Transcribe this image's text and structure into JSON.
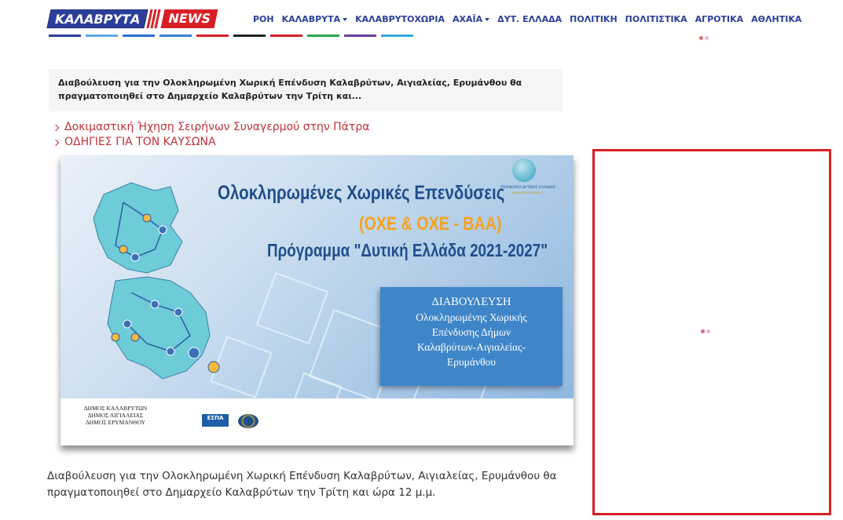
{
  "header": {
    "logo": {
      "main": "ΚΑΛΑΒΡΥΤΑ",
      "news": "NEWS"
    },
    "nav": [
      {
        "label": "ΡΟΗ",
        "dropdown": false
      },
      {
        "label": "ΚΑΛΑΒΡΥΤΑ",
        "dropdown": true
      },
      {
        "label": "ΚΑΛΑΒΡΥΤΟΧΩΡΙΑ",
        "dropdown": false
      },
      {
        "label": "ΑΧΑΪΑ",
        "dropdown": true
      },
      {
        "label": "ΔΥΤ. ΕΛΛΑΔΑ",
        "dropdown": false
      },
      {
        "label": "ΠΟΛΙΤΙΚΗ",
        "dropdown": false
      },
      {
        "label": "ΠΟΛΙΤΙΣΤΙΚΑ",
        "dropdown": false
      },
      {
        "label": "ΑΓΡΟΤΙΚΑ",
        "dropdown": false
      },
      {
        "label": "ΑΘΛΗΤΙΚΑ",
        "dropdown": false
      }
    ],
    "strip_colors": [
      "#2b3f9a",
      "#5aa9e6",
      "#2b6fd6",
      "#3d7fd0",
      "#d91f26",
      "#222222",
      "#d91f26",
      "#2ea84a",
      "#6a3fa0",
      "#31a9d8"
    ]
  },
  "article": {
    "summary": "Διαβούλευση για την Ολοκληρωμένη Χωρική Επένδυση Καλαβρύτων, Αιγιαλείας, Ερυμάνθου θα πραγματοποιηθεί στο Δημαρχείο Καλαβρύτων την Τρίτη και...",
    "related_links": [
      "Δοκιμαστική Ήχηση Σειρήνων Συναγερμού στην Πάτρα",
      "ΟΔΗΓΙΕΣ ΓΙΑ ΤΟΝ ΚΑΥΣΩΝΑ"
    ],
    "image": {
      "title1": "Ολοκληρωμένες Χωρικές Επενδύσεις",
      "title2": "(ΟΧΕ & ΟΧΕ - ΒΑΑ)",
      "title3": "Πρόγραμμα \"Δυτική Ελλάδα 2021-2027\"",
      "box_lines": [
        "ΔΙΑΒΟΥΛΕΥΣΗ",
        "Ολοκληρωμένης Χωρικής",
        "Επένδυσης Δήμων",
        "Καλαβρύτων-Αιγιαλείας-",
        "Ερυμάνθου"
      ],
      "municipalities": [
        "ΔΗΜΟΣ ΚΑΛΑΒΡΥΤΩΝ",
        "ΔΗΜΟΣ ΑΙΓΙΑΛΕΙΑΣ",
        "ΔΗΜΟΣ ΕΡΥΜΑΝΘΟΥ"
      ],
      "espa": "ΕΣΠΑ",
      "region_name": "ΠΕΡΙΦΕΡΕΙΑ ΔΥΤΙΚΗΣ ΕΛΛΑΔΑΣ",
      "region_slogan": "μπροστά σκέψεις!"
    },
    "body": "Διαβούλευση για την Ολοκληρωμένη Χωρική Επένδυση Καλαβρύτων, Αιγιαλείας, Ερυμάνθου θα πραγματοποιηθεί στο Δημαρχείο Καλαβρύτων την Τρίτη και ώρα 12 μ.μ."
  },
  "sidebar": {
    "loader_icon": "loading-dots-icon"
  }
}
